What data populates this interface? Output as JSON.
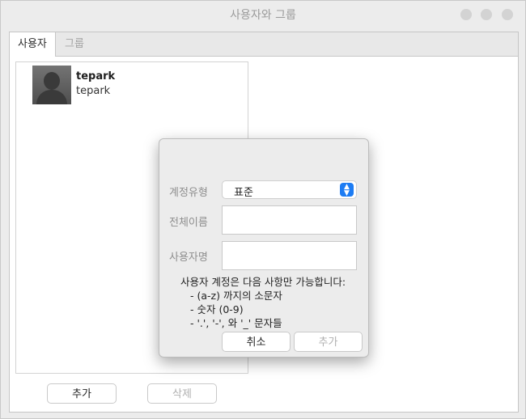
{
  "window": {
    "title": "사용자와 그룹"
  },
  "tabs": [
    {
      "label": "사용자",
      "active": true
    },
    {
      "label": "그룹",
      "active": false
    }
  ],
  "users": [
    {
      "name": "tepark",
      "login": "tepark"
    }
  ],
  "main_buttons": {
    "add": "추가",
    "delete": "삭제"
  },
  "dialog": {
    "account_type_label": "계정유형",
    "account_type_value": "표준",
    "full_name_label": "전체이름",
    "full_name_value": "",
    "username_label": "사용자명",
    "username_value": "",
    "rules_heading": "사용자 계정은 다음 사항만 가능합니다:",
    "rules": [
      "- (a-z) 까지의 소문자",
      "- 숫자 (0-9)",
      "- '.', '-', 와 '_' 문자들"
    ],
    "cancel_label": "취소",
    "add_label": "추가"
  },
  "colors": {
    "accent": "#1d7cf3"
  }
}
